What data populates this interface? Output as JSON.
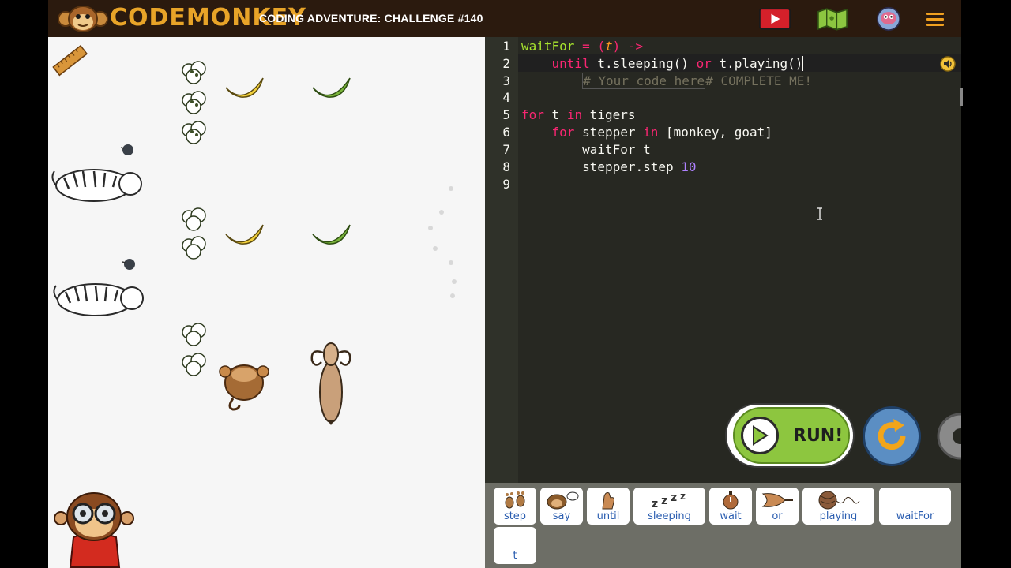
{
  "app": {
    "logo_text": "CODEMONKEY",
    "title": "CODING ADVENTURE: CHALLENGE #140"
  },
  "top_icons": [
    "play-video-icon",
    "map-icon",
    "avatar-icon",
    "hamburger-menu-icon"
  ],
  "editor": {
    "line_numbers": [
      "1",
      "2",
      "3",
      "4",
      "5",
      "6",
      "7",
      "8",
      "9"
    ],
    "lines": {
      "l1_a": "waitFor",
      "l1_b": " = (",
      "l1_c": "t",
      "l1_d": ") ->",
      "l2_a": "until",
      "l2_b": " t.sleeping() ",
      "l2_c": "or",
      "l2_d": " t.playing()",
      "l3_a": "# Your code here",
      "l3_b": "# COMPLETE ME!",
      "l5_a": "for",
      "l5_b": " t ",
      "l5_c": "in",
      "l5_d": " tigers",
      "l6_a": "for",
      "l6_b": " stepper ",
      "l6_c": "in",
      "l6_d": " [monkey, goat]",
      "l7_a": "waitFor t",
      "l8_a": "stepper.step ",
      "l8_b": "10"
    }
  },
  "buttons": {
    "run": "RUN!"
  },
  "palette": [
    {
      "label": "step",
      "icon": "footprints-icon"
    },
    {
      "label": "say",
      "icon": "monkey-speech-icon"
    },
    {
      "label": "until",
      "icon": "hand-stop-icon"
    },
    {
      "label": "sleeping",
      "icon": "zzz-icon"
    },
    {
      "label": "wait",
      "icon": "stopwatch-icon"
    },
    {
      "label": "or",
      "icon": "or-gate-icon"
    },
    {
      "label": "playing",
      "icon": "yarn-ball-icon"
    },
    {
      "label": "waitFor",
      "icon": ""
    },
    {
      "label": "t",
      "icon": ""
    }
  ],
  "colors": {
    "topbar": "#2b1a0e",
    "logo": "#e8a428",
    "editor_bg": "#272822",
    "keyword": "#f92672",
    "number": "#ae81ff",
    "run_green": "#8dc63f",
    "reset_blue": "#5b8ec3",
    "palette_bg": "#6d6e66",
    "palette_label": "#2a5db0"
  }
}
